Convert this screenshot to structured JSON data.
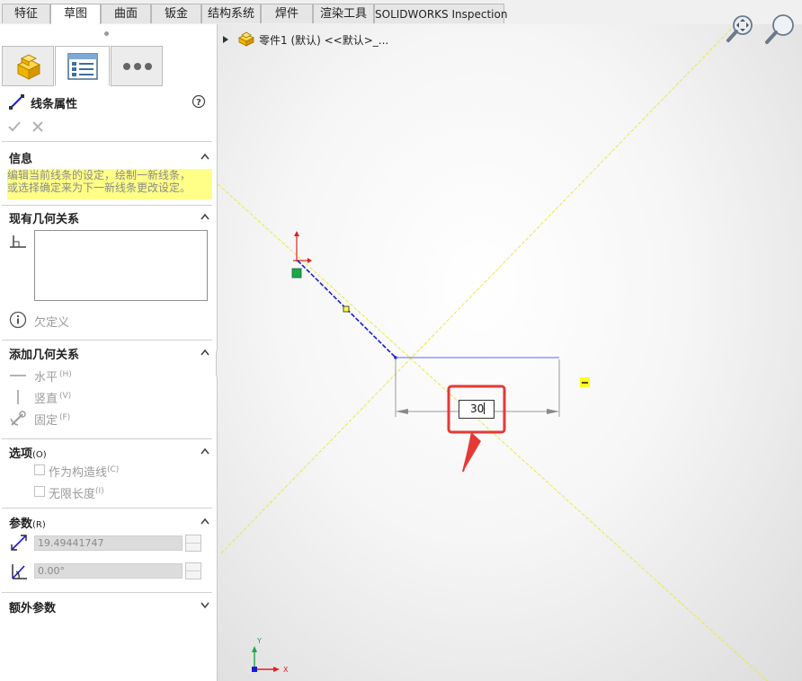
{
  "tabs": [
    "特征",
    "草图",
    "曲面",
    "钣金",
    "结构系统",
    "焊件",
    "渲染工具",
    "SOLIDWORKS Inspection"
  ],
  "panel": {
    "title": "线条属性",
    "info_title": "信息",
    "info_text_1": "编辑当前线条的设定，绘制一新线条，",
    "info_text_2": "或选择确定来为下一新线条更改设定。",
    "existing_relations_title": "现有几何关系",
    "under_defined": "欠定义",
    "add_relations_title": "添加几何关系",
    "horizontal": "水平",
    "horizontal_key": "(H)",
    "vertical": "竖直",
    "vertical_key": "(V)",
    "fix": "固定",
    "fix_key": "(F)",
    "options_title": "选项",
    "options_key": "(O)",
    "construction": "作为构造线",
    "construction_key": "(C)",
    "infinite": "无限长度",
    "infinite_key": "(I)",
    "params_title": "参数",
    "params_key": "(R)",
    "length_value": "19.49441747",
    "angle_value": "0.00°",
    "extra_params_title": "额外参数"
  },
  "tree": {
    "part_label": "零件1 (默认) <<默认>_..."
  },
  "sketch": {
    "dimension_value": "30"
  },
  "colors": {
    "highlight": "#ffff88",
    "accent": "#e53935",
    "sketch_line": "#1a1ad6",
    "dimension_line": "#6060ff"
  }
}
